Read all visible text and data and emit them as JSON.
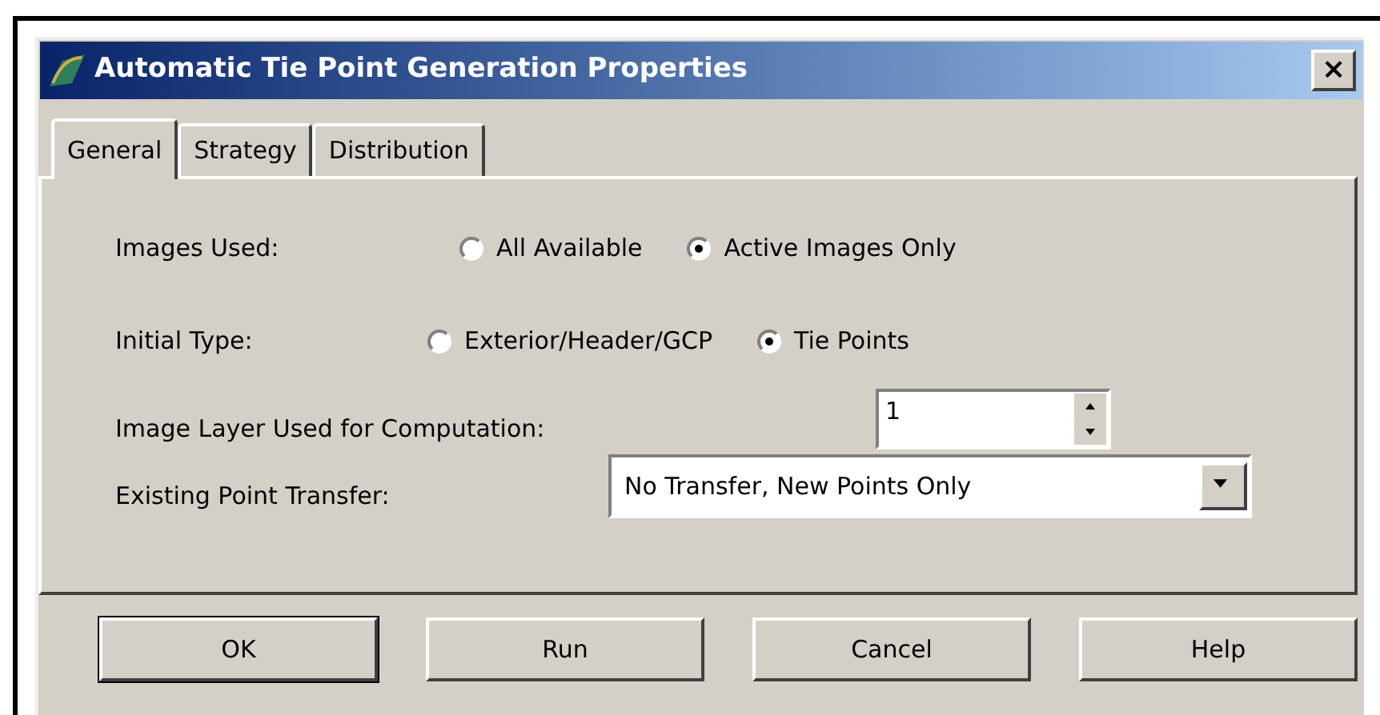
{
  "window": {
    "title": "Automatic Tie Point Generation Properties",
    "close": "×"
  },
  "tabs": [
    {
      "label": "General",
      "selected": true
    },
    {
      "label": "Strategy",
      "selected": false
    },
    {
      "label": "Distribution",
      "selected": false
    }
  ],
  "fields": [
    {
      "kind": "radio",
      "label": "Images Used:",
      "options": [
        {
          "label": "All Available",
          "selected": false
        },
        {
          "label": "Active Images Only",
          "selected": true
        }
      ]
    },
    {
      "kind": "radio",
      "label": "Initial Type:",
      "options": [
        {
          "label": "Exterior/Header/GCP",
          "selected": false
        },
        {
          "label": "Tie Points",
          "selected": true
        }
      ]
    },
    {
      "kind": "spin",
      "label": "Image Layer Used for Computation:",
      "value": "1"
    },
    {
      "kind": "dropdown",
      "label": "Existing Point Transfer:",
      "value": "No Transfer, New Points Only"
    }
  ],
  "buttons": [
    {
      "label": "OK",
      "default": true
    },
    {
      "label": "Run",
      "default": false
    },
    {
      "label": "Cancel",
      "default": false
    },
    {
      "label": "Help",
      "default": false
    }
  ]
}
